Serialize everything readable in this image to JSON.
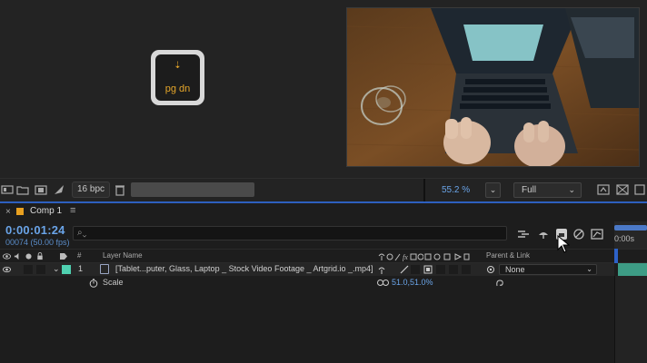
{
  "overlay_key": {
    "label": "pg dn",
    "icon": "arrow-down-icon"
  },
  "viewer_toolbar": {
    "bpc": "16 bpc",
    "zoom": "55.2 %",
    "resolution": "Full"
  },
  "composition_tab": {
    "close": "×",
    "name": "Comp 1",
    "menu": "≡"
  },
  "timeline": {
    "timecode": "0:00:01:24",
    "frames": "00074 (50.00 fps)",
    "search_icon": "search-icon",
    "ruler_label": "0:00s"
  },
  "layer_header": {
    "hash": "#",
    "layer_name": "Layer Name",
    "parent_link": "Parent & Link"
  },
  "layers": [
    {
      "number": "1",
      "name": "[Tablet...puter, Glass, Laptop _ Stock Video Footage _ Artgrid.io _.mp4]",
      "parent": "None",
      "label_color": "#4fd0b0"
    }
  ],
  "properties": [
    {
      "label": "Scale",
      "value": "51.0,51.0%"
    }
  ],
  "colors": {
    "accent_blue": "#6aa4e8",
    "comp_tab_color": "#e8a020",
    "key_text": "#e5a62a"
  }
}
